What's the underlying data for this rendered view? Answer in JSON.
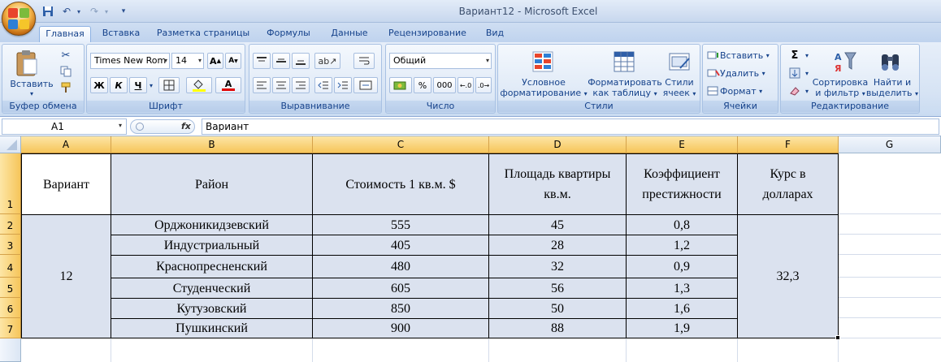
{
  "window": {
    "title": "Вариант12 - Microsoft Excel"
  },
  "qat": {
    "save_icon": "save-icon",
    "undo_icon": "undo-icon",
    "redo_icon": "redo-icon",
    "customize_icon": "customize-qat-icon"
  },
  "tabs": [
    "Главная",
    "Вставка",
    "Разметка страницы",
    "Формулы",
    "Данные",
    "Рецензирование",
    "Вид"
  ],
  "ribbon": {
    "clipboard": {
      "paste": "Вставить",
      "label": "Буфер обмена"
    },
    "font": {
      "name": "Times New Rom",
      "size": "14",
      "bold": "Ж",
      "italic": "К",
      "underline": "Ч",
      "label": "Шрифт"
    },
    "alignment": {
      "label": "Выравнивание"
    },
    "number": {
      "format": "Общий",
      "percent": "%",
      "thousands": "000",
      "label": "Число"
    },
    "styles": {
      "cond1": "Условное",
      "cond2": "форматирование",
      "table1": "Форматировать",
      "table2": "как таблицу",
      "cell1": "Стили",
      "cell2": "ячеек",
      "label": "Стили"
    },
    "cells": {
      "insert": "Вставить",
      "delete": "Удалить",
      "format": "Формат",
      "label": "Ячейки"
    },
    "editing": {
      "sort1": "Сортировка",
      "sort2": "и фильтр",
      "find1": "Найти и",
      "find2": "выделить",
      "label": "Редактирование"
    }
  },
  "formula_bar": {
    "name_box": "A1",
    "fx": "fx",
    "content": "Вариант"
  },
  "columns": [
    "A",
    "B",
    "C",
    "D",
    "E",
    "F",
    "G"
  ],
  "rows": [
    "1",
    "2",
    "3",
    "4",
    "5",
    "6",
    "7"
  ],
  "sheet": {
    "headers": [
      "Вариант",
      "Район",
      "Стоимость 1 кв.м. $",
      "Площадь квартиры кв.м.",
      "Коэффициент престижности",
      "Курс в долларах"
    ],
    "variant": "12",
    "rate": "32,3",
    "data": [
      [
        "Орджоникидзевский",
        "555",
        "45",
        "0,8"
      ],
      [
        "Индустриальный",
        "405",
        "28",
        "1,2"
      ],
      [
        "Краснопресненский",
        "480",
        "32",
        "0,9"
      ],
      [
        "Студенческий",
        "605",
        "56",
        "1,3"
      ],
      [
        "Кутузовский",
        "850",
        "50",
        "1,6"
      ],
      [
        "Пушкинский",
        "900",
        "88",
        "1,9"
      ]
    ]
  },
  "colors": {
    "accent": "#15428b",
    "header_highlight": "#f6c55a",
    "selection_fill": "#dbe2ef"
  }
}
